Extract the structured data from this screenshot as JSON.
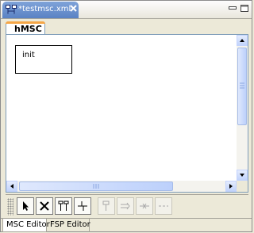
{
  "editor": {
    "tab_title": "*testmsc.xml",
    "tab_icon": "msc-diagram-icon"
  },
  "window_controls": [
    "minimize-icon",
    "maximize-icon"
  ],
  "diagram_tab": {
    "label": "hMSC"
  },
  "canvas": {
    "nodes": [
      {
        "label": "init"
      }
    ]
  },
  "palette": {
    "tools": [
      {
        "name": "select-tool",
        "icon": "arrow-pointer-icon",
        "enabled": true
      },
      {
        "name": "delete-tool",
        "icon": "x-cross-icon",
        "enabled": true
      },
      {
        "name": "parallel-tool",
        "icon": "parallel-lines-icon",
        "enabled": true
      },
      {
        "name": "connect-tool",
        "icon": "connection-icon",
        "enabled": true
      },
      {
        "name": "node-tool",
        "icon": "node-stem-icon",
        "enabled": false
      },
      {
        "name": "forward-arrow-tool",
        "icon": "double-arrow-right-icon",
        "enabled": false
      },
      {
        "name": "cross-arrow-tool",
        "icon": "arrow-cross-icon",
        "enabled": false
      },
      {
        "name": "dash-tool",
        "icon": "dashed-line-icon",
        "enabled": false
      }
    ]
  },
  "bottom_tabs": [
    {
      "label": "MSC Editor",
      "active": true
    },
    {
      "label": "FSP Editor",
      "active": false
    }
  ],
  "colors": {
    "active_tab": "#5a82c4",
    "tab_accent": "#f5a646",
    "scrollbar": "#c1d3fb"
  }
}
